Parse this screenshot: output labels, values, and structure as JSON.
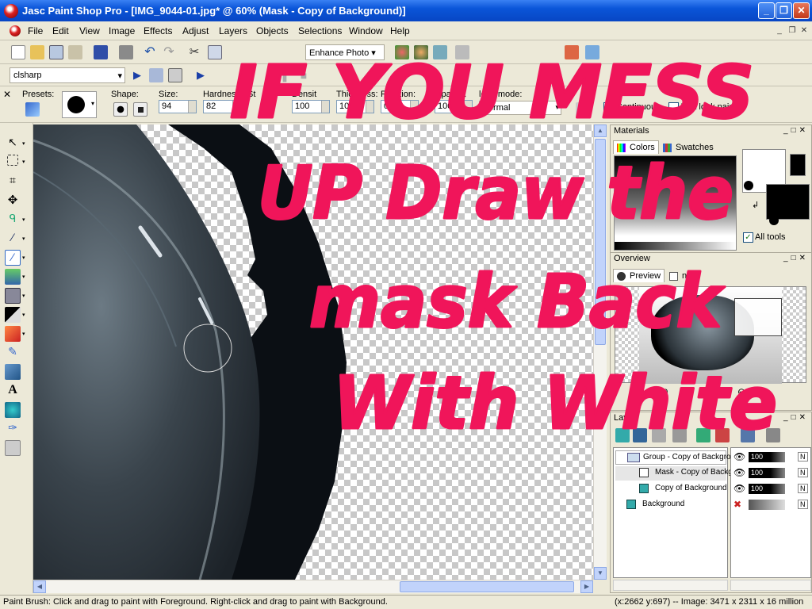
{
  "window": {
    "title": "Jasc Paint Shop Pro - [IMG_9044-01.jpg* @  60% (Mask - Copy of Background)]"
  },
  "menu": {
    "items": [
      "File",
      "Edit",
      "View",
      "Image",
      "Effects",
      "Adjust",
      "Layers",
      "Objects",
      "Selections",
      "Window",
      "Help"
    ]
  },
  "standard_toolbar": {
    "enhance_photo_label": "Enhance Photo"
  },
  "script_toolbar": {
    "script_name": "clsharp"
  },
  "tool_options": {
    "presets_label": "Presets:",
    "shape_label": "Shape:",
    "size_label": "Size:",
    "size_value": "94",
    "hardness_label": "Hardness:",
    "hardness_value": "82",
    "step_label": "St",
    "density_label": "Densit",
    "density_value": "100",
    "thickness_label": "Thickness:",
    "thickness_value": "100",
    "rotation_label": "Rotation:",
    "rotation_value": "0",
    "opacity_label": "Opacity:",
    "opacity_value": "100",
    "blend_mode_label": "lend mode:",
    "blend_mode_value": "Normal",
    "continuous_label": "Continuous",
    "wet_look_label": "Wet look paint"
  },
  "materials": {
    "title": "Materials",
    "tab_colors": "Colors",
    "tab_swatches": "Swatches",
    "all_tools_label": "All tools"
  },
  "overview": {
    "title": "Overview",
    "tab_preview": "Preview",
    "tab_info": "nfo",
    "zoom_value": "60",
    "zoom_suffix": "1"
  },
  "layers": {
    "title": "Lay",
    "rows": [
      {
        "name": "Group - Copy of Backgrou",
        "opacity": "100",
        "mode": "N"
      },
      {
        "name": "Mask - Copy of Backg",
        "opacity": "100",
        "mode": "N"
      },
      {
        "name": "Copy of Background",
        "opacity": "100",
        "mode": "N"
      },
      {
        "name": "Background",
        "opacity": "",
        "mode": "N"
      }
    ]
  },
  "graffiti": {
    "line1": "IF YOU MESS",
    "line2": "UP Draw the",
    "line3": "mask Back",
    "line4": "With White",
    "color": "#f0155a"
  },
  "status": {
    "hint": "Paint Brush: Click and drag to paint with Foreground. Right-click and drag to paint with Background.",
    "info": "(x:2662 y:697) -- Image:  3471 x 2311 x 16 million"
  }
}
